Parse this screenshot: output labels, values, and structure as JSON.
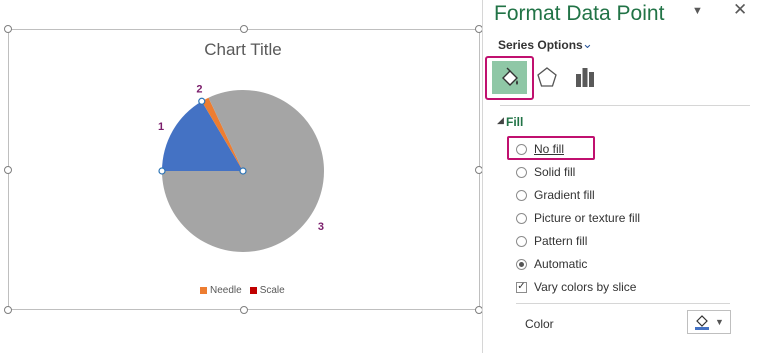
{
  "chart": {
    "title": "Chart Title",
    "slice_labels": [
      "1",
      "2",
      "3"
    ],
    "legend": [
      {
        "label": "Needle",
        "color": "#ed7d31"
      },
      {
        "label": "Scale",
        "color": "#c00000"
      }
    ]
  },
  "chart_data": {
    "type": "pie",
    "title": "Chart Title",
    "categories": [
      "1",
      "2",
      "3"
    ],
    "values": [
      16.5,
      1.5,
      82
    ],
    "colors": [
      "#4472c4",
      "#ed7d31",
      "#a5a5a5"
    ],
    "legend": [
      "Needle",
      "Scale"
    ],
    "legend_placement": "bottom"
  },
  "panel": {
    "title": "Format Data Point",
    "dropdown_icon": "chevron-down-icon",
    "close_icon": "close-icon",
    "series_options_label": "Series Options",
    "tabs": [
      "fill-line-icon",
      "effects-icon",
      "series-options-icon"
    ],
    "fill_section": "Fill",
    "options": [
      {
        "label": "No fill",
        "selected": false
      },
      {
        "label": "Solid fill",
        "selected": false
      },
      {
        "label": "Gradient fill",
        "selected": false
      },
      {
        "label": "Picture or texture fill",
        "selected": false
      },
      {
        "label": "Pattern fill",
        "selected": false
      },
      {
        "label": "Automatic",
        "selected": true
      }
    ],
    "vary_colors": {
      "label": "Vary colors by slice",
      "checked": true
    },
    "color_label": "Color",
    "accent_color": "#217346",
    "highlight_color": "#c0106f"
  }
}
